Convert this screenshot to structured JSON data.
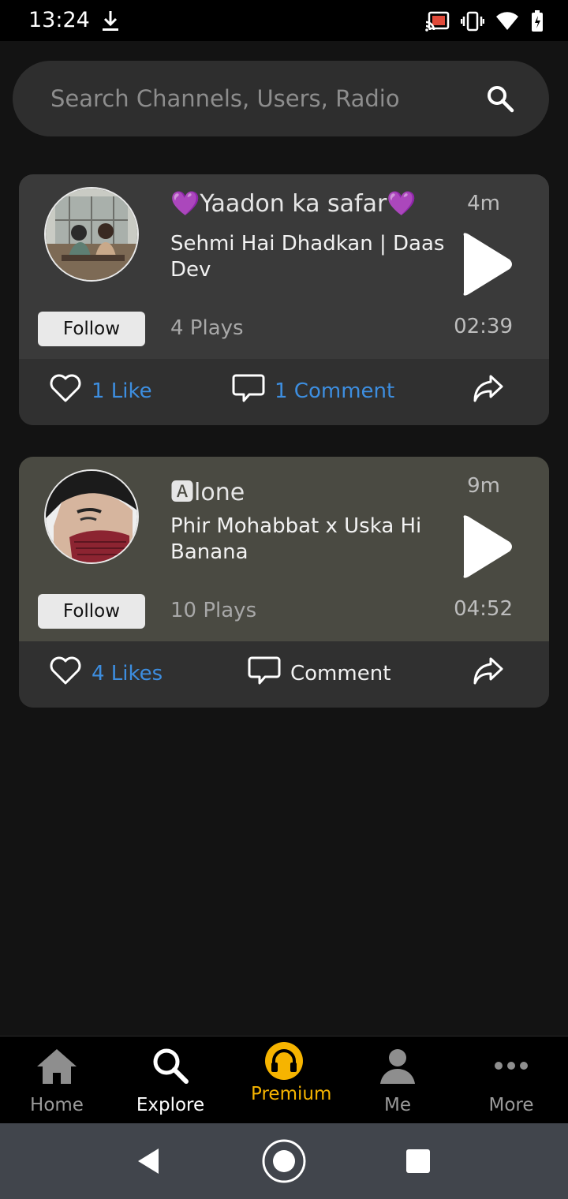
{
  "status_bar": {
    "time": "13:24"
  },
  "search": {
    "placeholder": "Search Channels, Users, Radio"
  },
  "posts": [
    {
      "author": "💜Yaadon ka safar💜",
      "time_ago": "4m",
      "title": "Sehmi Hai Dhadkan | Daas Dev",
      "follow_label": "Follow",
      "plays": "4 Plays",
      "duration": "02:39",
      "likes": "1 Like",
      "comments": "1 Comment",
      "card_color": "#3a3a3a"
    },
    {
      "author": "🅰lone",
      "time_ago": "9m",
      "title": "Phir Mohabbat x Uska Hi Banana",
      "follow_label": "Follow",
      "plays": "10 Plays",
      "duration": "04:52",
      "likes": "4 Likes",
      "comments": "Comment",
      "card_color": "#4a4a42"
    }
  ],
  "nav": {
    "home": "Home",
    "explore": "Explore",
    "premium": "Premium",
    "me": "Me",
    "more": "More"
  },
  "colors": {
    "accent": "#3d8ee0",
    "premium": "#f6b400",
    "background": "#131313"
  }
}
